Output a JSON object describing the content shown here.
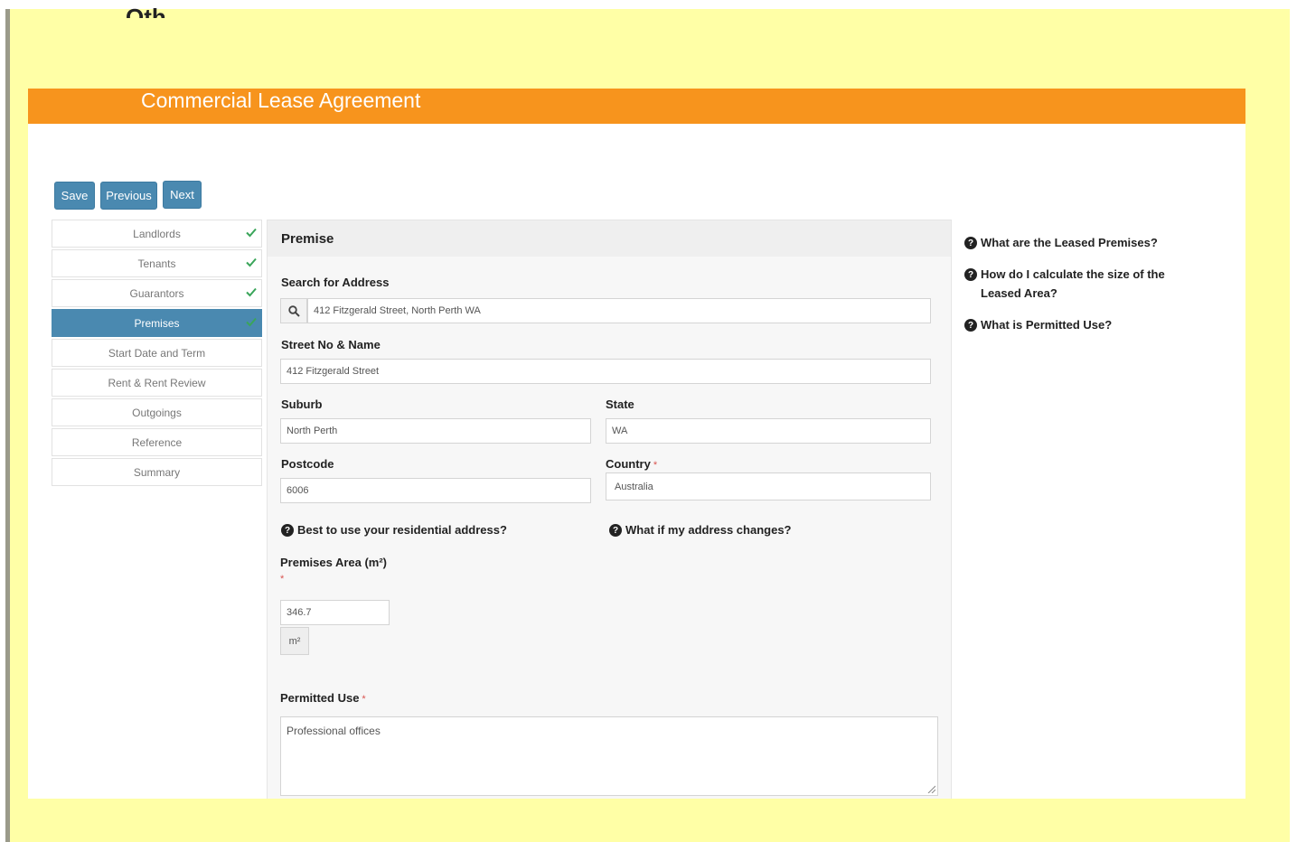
{
  "header": {
    "cut_text": "Oth",
    "app_title": "Commercial Lease Agreement"
  },
  "toolbar": {
    "save_label": "Save",
    "previous_label": "Previous",
    "next_label": "Next"
  },
  "steps": [
    {
      "label": "Landlords",
      "done": true
    },
    {
      "label": "Tenants",
      "done": true
    },
    {
      "label": "Guarantors",
      "done": true
    },
    {
      "label": "Premises",
      "done": true,
      "active": true
    },
    {
      "label": "Start Date and Term",
      "done": false
    },
    {
      "label": "Rent & Rent Review",
      "done": false
    },
    {
      "label": "Outgoings",
      "done": false
    },
    {
      "label": "Reference",
      "done": false
    },
    {
      "label": "Summary",
      "done": false
    }
  ],
  "form": {
    "title": "Premise",
    "search": {
      "label": "Search for Address",
      "value": "412 Fitzgerald Street, North Perth WA"
    },
    "street": {
      "label": "Street No & Name",
      "value": "412 Fitzgerald Street"
    },
    "suburb": {
      "label": "Suburb",
      "value": "North Perth"
    },
    "state": {
      "label": "State",
      "value": "WA"
    },
    "postcode": {
      "label": "Postcode",
      "value": "6006"
    },
    "country": {
      "label": "Country",
      "required_mark": "*",
      "value": "Australia"
    },
    "help_residential": "Best to use your residential address?",
    "help_changes": "What if my address changes?",
    "area": {
      "label": "Premises Area (m²)",
      "required_mark": "*",
      "value": "346.7",
      "unit": "m²"
    },
    "permitted": {
      "label": "Permitted Use",
      "required_mark": "*",
      "value": "Professional offices"
    }
  },
  "side_help": [
    "What are the Leased Premises?",
    "How do I calculate the size of the Leased Area?",
    "What is Permitted Use?"
  ],
  "colors": {
    "banner": "#f7941d",
    "button": "#4a89b0",
    "check": "#3aa55a",
    "frame": "#ffffa6"
  },
  "icons": {
    "search": "search-icon",
    "check": "check-icon",
    "help": "question-circle-icon"
  }
}
